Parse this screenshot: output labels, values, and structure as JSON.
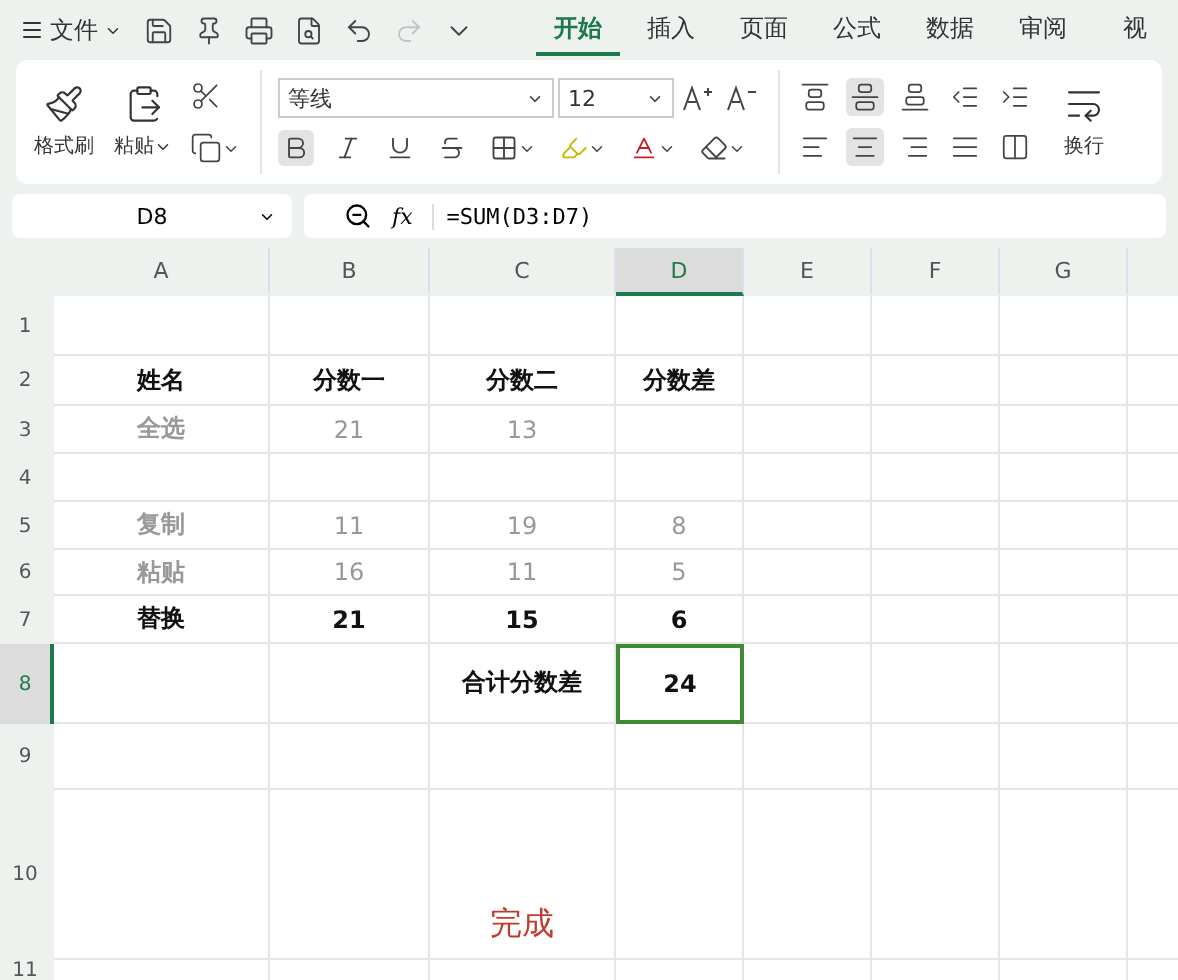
{
  "file_menu": {
    "label": "文件"
  },
  "quick_access": [
    {
      "kind": "save",
      "disabled": false
    },
    {
      "kind": "pin",
      "disabled": false
    },
    {
      "kind": "print",
      "disabled": false
    },
    {
      "kind": "preview",
      "disabled": false
    },
    {
      "kind": "undo",
      "disabled": false
    },
    {
      "kind": "redo",
      "disabled": true
    },
    {
      "kind": "more",
      "disabled": false
    }
  ],
  "tabs": [
    {
      "label": "开始",
      "selected": true
    },
    {
      "label": "插入",
      "selected": false
    },
    {
      "label": "页面",
      "selected": false
    },
    {
      "label": "公式",
      "selected": false
    },
    {
      "label": "数据",
      "selected": false
    },
    {
      "label": "审阅",
      "selected": false
    },
    {
      "label": "视",
      "selected": false
    }
  ],
  "clipboard": [
    {
      "kind": "format-painter",
      "label": "格式刷",
      "dropdown": false
    },
    {
      "kind": "paste",
      "label": "粘贴",
      "dropdown": true
    },
    {
      "kind": "cut",
      "dropdown": false
    },
    {
      "kind": "copy",
      "dropdown": true
    }
  ],
  "font": {
    "name": "等线",
    "size": "12"
  },
  "format_buttons": [
    {
      "kind": "bold",
      "selected": true,
      "dropdown": false
    },
    {
      "kind": "italic",
      "selected": false,
      "dropdown": false
    },
    {
      "kind": "underline",
      "selected": false,
      "dropdown": false
    },
    {
      "kind": "strike",
      "selected": false,
      "dropdown": false
    },
    {
      "kind": "borders",
      "selected": false,
      "dropdown": true
    },
    {
      "kind": "highlight",
      "selected": false,
      "dropdown": true
    },
    {
      "kind": "font-color",
      "selected": false,
      "dropdown": true
    },
    {
      "kind": "clear",
      "selected": false,
      "dropdown": true
    }
  ],
  "align_top": [
    {
      "kind": "top",
      "selected": false
    },
    {
      "kind": "middle",
      "selected": true
    },
    {
      "kind": "bottom",
      "selected": false
    },
    {
      "kind": "outdent",
      "selected": false
    },
    {
      "kind": "indent",
      "selected": false
    }
  ],
  "align_bottom": [
    {
      "kind": "left",
      "selected": false
    },
    {
      "kind": "center",
      "selected": true
    },
    {
      "kind": "right",
      "selected": false
    },
    {
      "kind": "justify",
      "selected": false
    },
    {
      "kind": "distribute",
      "selected": false
    }
  ],
  "wrap": {
    "label": "换行"
  },
  "name_box": "D8",
  "function_label": "fx",
  "formula": "=SUM(D3:D7)",
  "columns": [
    {
      "label": "A",
      "selected": false
    },
    {
      "label": "B",
      "selected": false
    },
    {
      "label": "C",
      "selected": false
    },
    {
      "label": "D",
      "selected": true
    },
    {
      "label": "E",
      "selected": false
    },
    {
      "label": "F",
      "selected": false
    },
    {
      "label": "G",
      "selected": false
    }
  ],
  "rows": [
    {
      "number": "1",
      "selected": false,
      "cells": []
    },
    {
      "number": "2",
      "selected": false,
      "cells": [
        {
          "text": "姓名",
          "bold": true,
          "muted": false
        },
        {
          "text": "分数一",
          "bold": true,
          "muted": false
        },
        {
          "text": "分数二",
          "bold": true,
          "muted": false
        },
        {
          "text": "分数差",
          "bold": true,
          "muted": false
        }
      ]
    },
    {
      "number": "3",
      "selected": false,
      "cells": [
        {
          "text": "全选",
          "bold": true,
          "muted": true
        },
        {
          "text": "21",
          "bold": false,
          "muted": true
        },
        {
          "text": "13",
          "bold": false,
          "muted": true
        },
        null
      ]
    },
    {
      "number": "4",
      "selected": false,
      "cells": []
    },
    {
      "number": "5",
      "selected": false,
      "cells": [
        {
          "text": "复制",
          "bold": true,
          "muted": true
        },
        {
          "text": "11",
          "bold": false,
          "muted": true
        },
        {
          "text": "19",
          "bold": false,
          "muted": true
        },
        {
          "text": "8",
          "bold": false,
          "muted": true
        }
      ]
    },
    {
      "number": "6",
      "selected": false,
      "cells": [
        {
          "text": "粘贴",
          "bold": true,
          "muted": true
        },
        {
          "text": "16",
          "bold": false,
          "muted": true
        },
        {
          "text": "11",
          "bold": false,
          "muted": true
        },
        {
          "text": "5",
          "bold": false,
          "muted": true
        }
      ]
    },
    {
      "number": "7",
      "selected": false,
      "cells": [
        {
          "text": "替换",
          "bold": true,
          "muted": false
        },
        {
          "text": "21",
          "bold": true,
          "muted": false
        },
        {
          "text": "15",
          "bold": true,
          "muted": false
        },
        {
          "text": "6",
          "bold": true,
          "muted": false
        }
      ]
    },
    {
      "number": "8",
      "selected": true,
      "cells": [
        null,
        null,
        {
          "text": "合计分数差",
          "bold": true,
          "muted": false
        },
        {
          "text": "24",
          "bold": true,
          "muted": false,
          "selected": true
        }
      ]
    },
    {
      "number": "9",
      "selected": false,
      "cells": []
    },
    {
      "number": "10",
      "selected": false,
      "cells": [
        null,
        null,
        {
          "text": "完成",
          "bold": false,
          "color": "#c0392b"
        }
      ]
    },
    {
      "number": "11",
      "selected": false,
      "cells": []
    }
  ]
}
